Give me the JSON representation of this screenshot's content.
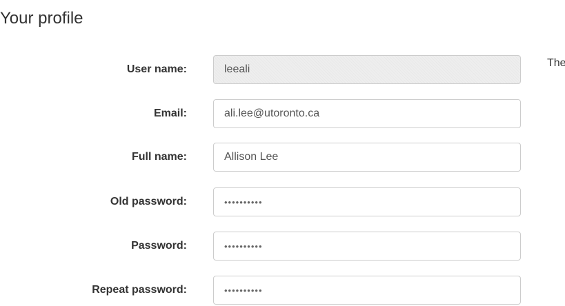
{
  "page": {
    "title": "Your profile",
    "side_text": "The"
  },
  "form": {
    "username": {
      "label": "User name:",
      "value": "leeali"
    },
    "email": {
      "label": "Email:",
      "value": "ali.lee@utoronto.ca"
    },
    "full_name": {
      "label": "Full name:",
      "value": "Allison Lee"
    },
    "old_password": {
      "label": "Old password:",
      "value": "••••••••••"
    },
    "password": {
      "label": "Password:",
      "value": "••••••••••"
    },
    "repeat_password": {
      "label": "Repeat password:",
      "value": "••••••••••"
    }
  }
}
